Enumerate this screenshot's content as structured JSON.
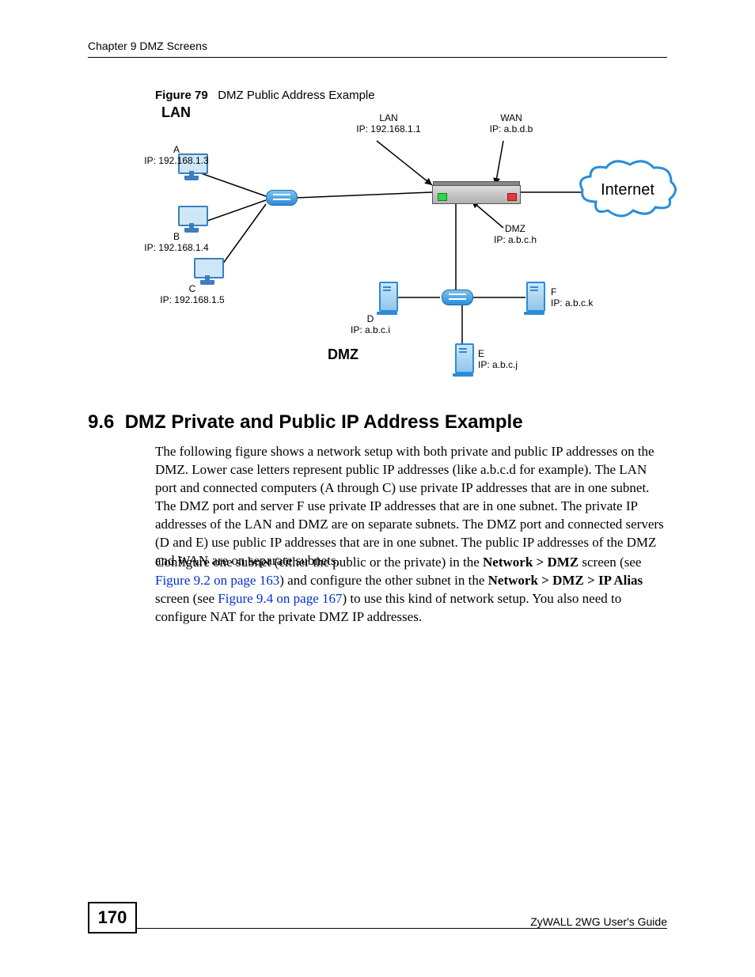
{
  "header": {
    "chapter": "Chapter 9 DMZ Screens"
  },
  "figure": {
    "number": "Figure 79",
    "title": "DMZ Public Address Example"
  },
  "diagram": {
    "lan_title": "LAN",
    "dmz_title": "DMZ",
    "internet": "Internet",
    "lan_port": {
      "label": "LAN",
      "ip": "IP: 192.168.1.1"
    },
    "wan_port": {
      "label": "WAN",
      "ip": "IP: a.b.d.b"
    },
    "dmz_port": {
      "label": "DMZ",
      "ip": "IP: a.b.c.h"
    },
    "hosts": {
      "A": {
        "label": "A",
        "ip": "IP: 192.168.1.3"
      },
      "B": {
        "label": "B",
        "ip": "IP: 192.168.1.4"
      },
      "C": {
        "label": "C",
        "ip": "IP: 192.168.1.5"
      },
      "D": {
        "label": "D",
        "ip": "IP: a.b.c.i"
      },
      "E": {
        "label": "E",
        "ip": "IP: a.b.c.j"
      },
      "F": {
        "label": "F",
        "ip": "IP: a.b.c.k"
      }
    }
  },
  "section": {
    "number": "9.6",
    "title": "DMZ Private and Public IP Address Example",
    "p1": "The following figure shows a network setup with both private and public IP addresses on the DMZ.  Lower case letters represent public IP addresses (like a.b.c.d for example). The LAN port and connected computers (A through C) use private IP addresses that are in one subnet. The DMZ port and server F use private IP addresses that are in one subnet.  The private IP addresses of the LAN and DMZ are on separate subnets. The DMZ port and connected servers (D and E) use public IP addresses that are in one subnet. The public IP addresses of the DMZ and WAN are on separate subnets.",
    "p2a": "Configure one subnet (either the public or the private) in the ",
    "p2_bold1": "Network > DMZ",
    "p2b": "  screen (see ",
    "link1": "Figure 9.2 on page 163",
    "p2c": ") and configure the other subnet in the ",
    "p2_bold2": "Network > DMZ > IP Alias",
    "p2d": " screen (see ",
    "link2": "Figure 9.4 on page 167",
    "p2e": ") to use this kind of network setup. You also need to configure NAT for the private DMZ IP addresses."
  },
  "footer": {
    "page": "170",
    "guide": "ZyWALL 2WG User's Guide"
  }
}
